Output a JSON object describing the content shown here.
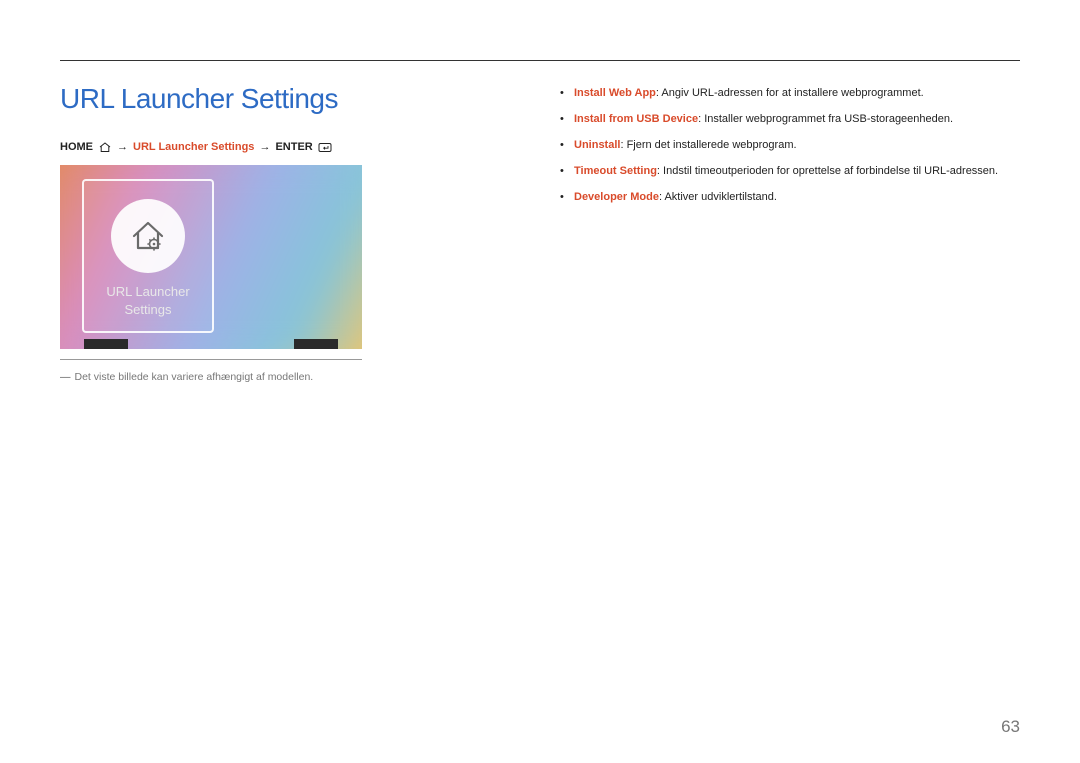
{
  "title": "URL Launcher Settings",
  "breadcrumb": {
    "home": "HOME",
    "step": "URL Launcher Settings",
    "enter": "ENTER",
    "arrow": "→"
  },
  "tile": {
    "line1": "URL Launcher",
    "line2": "Settings"
  },
  "caption": "Det viste billede kan variere afhængigt af modellen.",
  "caption_dash": "―",
  "bullets": [
    {
      "term": "Install Web App",
      "desc": ": Angiv URL-adressen for at installere webprogrammet."
    },
    {
      "term": "Install from USB Device",
      "desc": ": Installer webprogrammet fra USB-storageenheden."
    },
    {
      "term": "Uninstall",
      "desc": ": Fjern det installerede webprogram."
    },
    {
      "term": "Timeout Setting",
      "desc": ": Indstil timeoutperioden for oprettelse af forbindelse til URL-adressen."
    },
    {
      "term": "Developer Mode",
      "desc": ": Aktiver udviklertilstand."
    }
  ],
  "page_number": "63"
}
